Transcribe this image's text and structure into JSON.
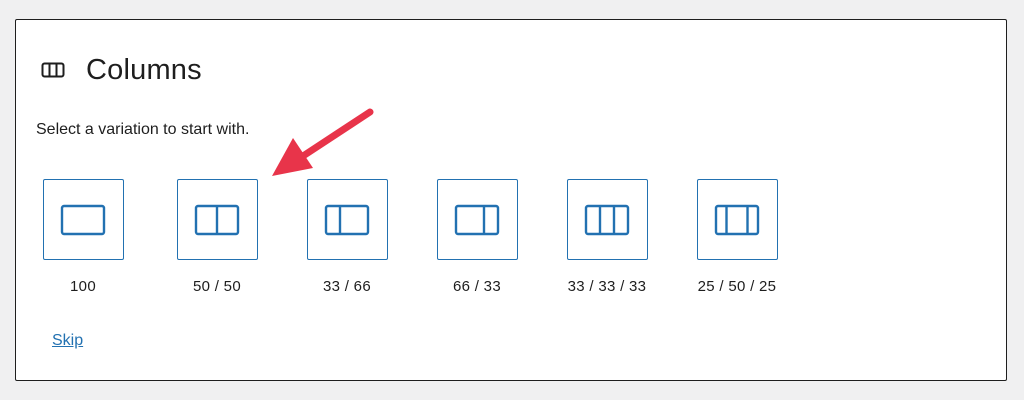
{
  "block": {
    "title": "Columns",
    "icon": "columns-icon",
    "instructions": "Select a variation to start with."
  },
  "variations": [
    {
      "label": "100",
      "icon": "layout-100-icon"
    },
    {
      "label": "50 / 50",
      "icon": "layout-50-50-icon"
    },
    {
      "label": "33 / 66",
      "icon": "layout-33-66-icon"
    },
    {
      "label": "66 / 33",
      "icon": "layout-66-33-icon"
    },
    {
      "label": "33 / 33 / 33",
      "icon": "layout-33-33-33-icon"
    },
    {
      "label": "25 / 50 / 25",
      "icon": "layout-25-50-25-icon"
    }
  ],
  "skip_label": "Skip",
  "colors": {
    "accent": "#2271b1",
    "annotation_arrow": "#e8344a",
    "text": "#1e1e1e"
  }
}
